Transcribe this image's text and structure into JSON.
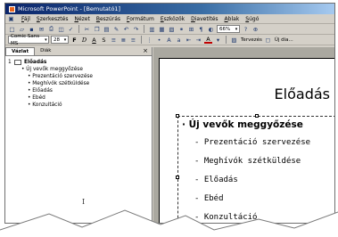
{
  "window": {
    "title": "Microsoft PowerPoint - [Bemutató1]"
  },
  "menu": [
    "Fájl",
    "Szerkesztés",
    "Nézet",
    "Beszúrás",
    "Formátum",
    "Eszközök",
    "Diavetítés",
    "Ablak",
    "Súgó"
  ],
  "toolbar": {
    "font": "Comic Sans MS",
    "size": "28",
    "bold": "F",
    "italic": "D",
    "underline": "A",
    "strike": "S",
    "zoom": "66%",
    "fontcolor": "A",
    "layout": "Tervezés",
    "newslide": "Új dia..."
  },
  "pane": {
    "tab_outline": "Vázlat",
    "tab_slides": "Diák",
    "close": "×"
  },
  "outline": {
    "num": "1",
    "title": "Előadás",
    "level1": "Új vevők meggyőzése",
    "level2": [
      "Prezentáció szervezése",
      "Meghívók szétküldése",
      "Előadás",
      "Ebéd",
      "Konzultáció"
    ]
  },
  "slide": {
    "title": "Előadás",
    "bullet1": "Új vevők meggyőzése",
    "bullets": [
      "Prezentáció szervezése",
      "Meghívók szétküldése",
      "Előadás",
      "Ebéd",
      "Konzultáció"
    ]
  },
  "cursor": "I"
}
